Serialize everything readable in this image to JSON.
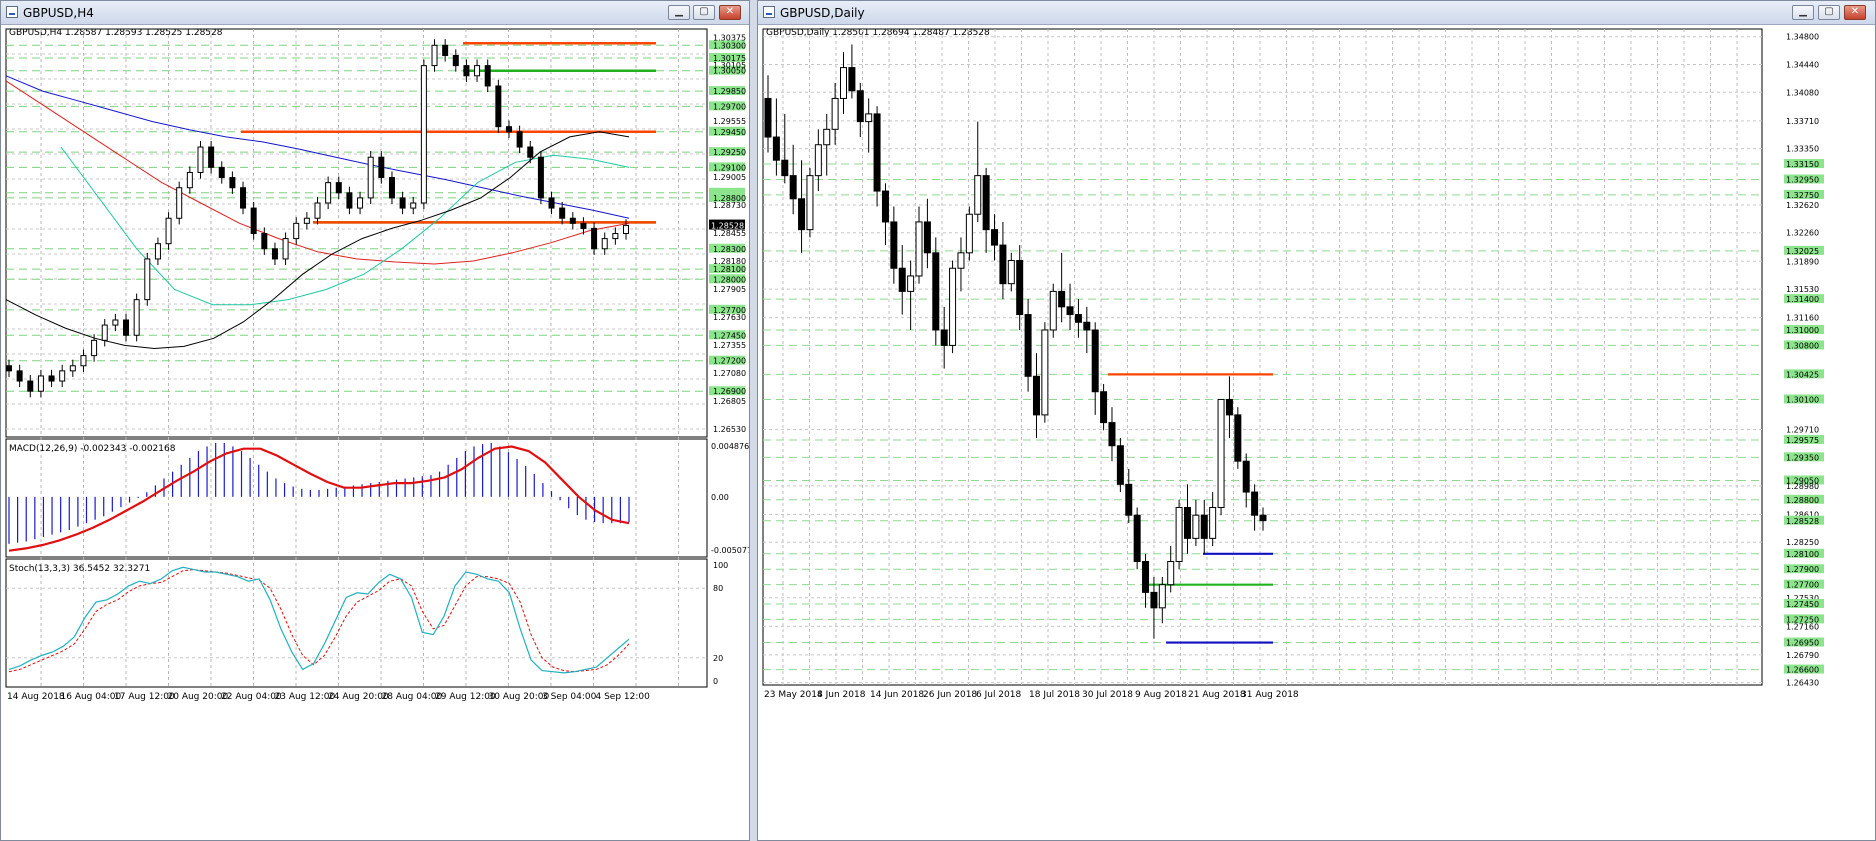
{
  "left_window": {
    "title": "GBPUSD,H4",
    "header": "GBPUSD,H4  1.28587 1.28593 1.28525 1.28528",
    "price_scale": [
      "1.30375",
      "1.30300",
      "1.30175",
      "1.30105",
      "1.30050",
      "1.29850",
      "1.29700",
      "1.29555",
      "1.29450",
      "1.29250",
      "1.29100",
      "1.29005",
      "1.28800",
      "1.28730",
      "1.28528",
      "1.28455",
      "1.28300",
      "1.28180",
      "1.28100",
      "1.28000",
      "1.27905",
      "1.27700",
      "1.27630",
      "1.27450",
      "1.27355",
      "1.27200",
      "1.27080",
      "1.26900",
      "1.26805",
      "1.26530"
    ],
    "price_levels_green": [
      1.303,
      1.30175,
      1.3005,
      1.2985,
      1.297,
      1.2945,
      1.2925,
      1.291,
      1.2885,
      1.288,
      1.283,
      1.281,
      1.28,
      1.277,
      1.2745,
      1.272,
      1.269
    ],
    "current_price": "1.28528",
    "dates": [
      "14 Aug 2018",
      "16 Aug 04:00",
      "17 Aug 12:00",
      "20 Aug 20:00",
      "22 Aug 04:00",
      "23 Aug 12:00",
      "24 Aug 20:00",
      "28 Aug 04:00",
      "29 Aug 12:00",
      "30 Aug 20:00",
      "3 Sep 04:00",
      "4 Sep 12:00"
    ],
    "macd_label": "MACD(12,26,9) -0.002343 -0.002168",
    "macd_scale": [
      "0.004876",
      "0.00",
      "-0.005077"
    ],
    "stoch_label": "Stoch(13,3,3) 36.5452 32.3271",
    "stoch_scale": [
      "100",
      "80",
      "20",
      "0"
    ],
    "horizontal_lines": [
      {
        "price": 1.3032,
        "color": "#ff4500"
      },
      {
        "price": 1.3005,
        "color": "#22b022"
      },
      {
        "price": 1.2945,
        "color": "#22b022"
      },
      {
        "price": 1.2945,
        "color": "#ff4500",
        "partial": true
      },
      {
        "price": 1.2856,
        "color": "#22b022"
      },
      {
        "price": 1.2856,
        "color": "#ff4500",
        "partial": true
      }
    ]
  },
  "right_window": {
    "title": "GBPUSD,Daily",
    "header": "GBPUSD,Daily  1.28501 1.28694 1.28487 1.28528",
    "price_scale": [
      "1.34800",
      "1.34440",
      "1.34080",
      "1.33710",
      "1.33350",
      "1.33150",
      "1.32950",
      "1.32750",
      "1.32620",
      "1.32260",
      "1.32025",
      "1.31890",
      "1.31530",
      "1.31400",
      "1.31160",
      "1.31000",
      "1.30800",
      "1.30425",
      "1.30100",
      "1.29710",
      "1.29575",
      "1.29350",
      "1.29050",
      "1.28980",
      "1.28800",
      "1.28610",
      "1.28528",
      "1.28250",
      "1.28100",
      "1.27900",
      "1.27700",
      "1.27530",
      "1.27450",
      "1.27250",
      "1.27160",
      "1.26950",
      "1.26790",
      "1.26600",
      "1.26430"
    ],
    "dates": [
      "23 May 2018",
      "4 Jun 2018",
      "14 Jun 2018",
      "26 Jun 2018",
      "6 Jul 2018",
      "18 Jul 2018",
      "30 Jul 2018",
      "9 Aug 2018",
      "21 Aug 2018",
      "31 Aug 2018"
    ],
    "horizontal_lines": [
      {
        "price": 1.30425,
        "color": "#ff4500"
      },
      {
        "price": 1.281,
        "color": "#1010c0"
      },
      {
        "price": 1.277,
        "color": "#22b022"
      },
      {
        "price": 1.2695,
        "color": "#1010c0"
      }
    ]
  },
  "chart_data": [
    {
      "type": "candlestick",
      "title": "GBPUSD,H4",
      "ylim": [
        1.2645,
        1.3046
      ],
      "x_ticks": [
        "14 Aug 2018",
        "16 Aug 04:00",
        "17 Aug 12:00",
        "20 Aug 20:00",
        "22 Aug 04:00",
        "23 Aug 12:00",
        "24 Aug 20:00",
        "28 Aug 04:00",
        "29 Aug 12:00",
        "30 Aug 20:00",
        "3 Sep 04:00",
        "4 Sep 12:00"
      ],
      "close_path": [
        1.271,
        1.27,
        1.269,
        1.2705,
        1.27,
        1.271,
        1.2715,
        1.2725,
        1.274,
        1.2755,
        1.276,
        1.2745,
        1.278,
        1.282,
        1.2835,
        1.286,
        1.289,
        1.2905,
        1.293,
        1.291,
        1.29,
        1.289,
        1.287,
        1.2845,
        1.283,
        1.282,
        1.284,
        1.2855,
        1.286,
        1.2875,
        1.2895,
        1.2885,
        1.287,
        1.288,
        1.292,
        1.29,
        1.288,
        1.287,
        1.2875,
        1.301,
        1.303,
        1.302,
        1.301,
        1.3,
        1.301,
        1.299,
        1.295,
        1.2945,
        1.293,
        1.292,
        1.288,
        1.287,
        1.286,
        1.2855,
        1.285,
        1.283,
        1.284,
        1.2845,
        1.2853
      ],
      "ma_black": [
        1.278,
        1.2765,
        1.2752,
        1.2742,
        1.2735,
        1.2732,
        1.2734,
        1.2742,
        1.2758,
        1.278,
        1.2805,
        1.2825,
        1.284,
        1.285,
        1.2858,
        1.2868,
        1.288,
        1.29,
        1.2925,
        1.294,
        1.2945,
        1.294
      ],
      "ma_blue": [
        1.3,
        1.2985,
        1.2975,
        1.2965,
        1.2955,
        1.2947,
        1.294,
        1.2935,
        1.2928,
        1.292,
        1.2912,
        1.2905,
        1.2898,
        1.289,
        1.2882,
        1.2875,
        1.2868,
        1.286
      ],
      "ma_red": [
        1.2995,
        1.297,
        1.2945,
        1.292,
        1.2895,
        1.2875,
        1.2855,
        1.284,
        1.2827,
        1.282,
        1.2817,
        1.2815,
        1.2818,
        1.2826,
        1.2836,
        1.2848,
        1.2855
      ],
      "ma_cyan": [
        1.293,
        1.288,
        1.283,
        1.279,
        1.2775,
        1.2775,
        1.278,
        1.279,
        1.2805,
        1.283,
        1.286,
        1.2895,
        1.2915,
        1.2922,
        1.2918,
        1.291
      ]
    },
    {
      "type": "bar",
      "title": "MACD(12,26,9)",
      "ylim": [
        -0.005077,
        0.004876
      ],
      "histogram": [
        -0.0041,
        -0.004,
        -0.0039,
        -0.0037,
        -0.0035,
        -0.0033,
        -0.0031,
        -0.0029,
        -0.0026,
        -0.0023,
        -0.002,
        -0.0017,
        -0.0013,
        -0.0009,
        -0.0005,
        -0.0001,
        0.0004,
        0.001,
        0.0016,
        0.0022,
        0.0028,
        0.0034,
        0.004,
        0.0044,
        0.0047,
        0.0047,
        0.0044,
        0.004,
        0.0034,
        0.0028,
        0.0022,
        0.0016,
        0.0012,
        0.0009,
        0.0007,
        0.0006,
        0.0006,
        0.0007,
        0.0008,
        0.0009,
        0.001,
        0.0011,
        0.0012,
        0.0013,
        0.0014,
        0.0015,
        0.0016,
        0.0017,
        0.0018,
        0.0019,
        0.0022,
        0.0028,
        0.0034,
        0.004,
        0.0044,
        0.0046,
        0.0047,
        0.0044,
        0.0039,
        0.0033,
        0.0027,
        0.002,
        0.0012,
        0.0005,
        -0.0003,
        -0.001,
        -0.0016,
        -0.002,
        -0.0022,
        -0.0023,
        -0.0023,
        -0.0023,
        -0.0022
      ],
      "signal": [
        -0.0047,
        -0.0045,
        -0.0042,
        -0.0038,
        -0.0033,
        -0.0027,
        -0.002,
        -0.0012,
        -0.0004,
        0.0005,
        0.0014,
        0.0022,
        0.0031,
        0.0038,
        0.0042,
        0.0042,
        0.0036,
        0.0028,
        0.002,
        0.0013,
        0.0008,
        0.0008,
        0.001,
        0.0012,
        0.0012,
        0.0014,
        0.0017,
        0.0024,
        0.0034,
        0.0042,
        0.0044,
        0.004,
        0.003,
        0.0015,
        0.0,
        -0.0012,
        -0.002,
        -0.0023
      ]
    },
    {
      "type": "line",
      "title": "Stoch(13,3,3)",
      "ylim": [
        0,
        100
      ],
      "main": [
        10,
        13,
        18,
        22,
        25,
        30,
        38,
        55,
        68,
        70,
        75,
        82,
        86,
        84,
        88,
        95,
        98,
        96,
        94,
        94,
        92,
        90,
        86,
        88,
        70,
        45,
        25,
        10,
        15,
        32,
        52,
        72,
        76,
        75,
        85,
        92,
        88,
        72,
        42,
        40,
        56,
        82,
        94,
        92,
        88,
        86,
        76,
        45,
        18,
        9,
        8,
        7,
        8,
        10,
        12,
        20,
        28,
        36
      ],
      "signal": [
        8,
        10,
        14,
        18,
        22,
        26,
        32,
        45,
        60,
        66,
        70,
        77,
        82,
        84,
        85,
        90,
        95,
        96,
        95,
        94,
        93,
        91,
        89,
        87,
        80,
        62,
        40,
        22,
        14,
        22,
        38,
        56,
        68,
        73,
        78,
        86,
        88,
        82,
        60,
        45,
        48,
        65,
        82,
        90,
        90,
        88,
        84,
        68,
        40,
        20,
        12,
        9,
        8,
        9,
        10,
        14,
        22,
        32
      ]
    },
    {
      "type": "candlestick",
      "title": "GBPUSD,Daily",
      "ylim": [
        1.264,
        1.349
      ],
      "x_ticks": [
        "23 May 2018",
        "4 Jun 2018",
        "14 Jun 2018",
        "26 Jun 2018",
        "6 Jul 2018",
        "18 Jul 2018",
        "30 Jul 2018",
        "9 Aug 2018",
        "21 Aug 2018",
        "31 Aug 2018"
      ],
      "candles": [
        [
          1.34,
          1.343,
          1.333,
          1.335
        ],
        [
          1.335,
          1.34,
          1.33,
          1.332
        ],
        [
          1.332,
          1.338,
          1.329,
          1.33
        ],
        [
          1.33,
          1.334,
          1.325,
          1.327
        ],
        [
          1.327,
          1.332,
          1.32,
          1.323
        ],
        [
          1.323,
          1.331,
          1.322,
          1.33
        ],
        [
          1.33,
          1.336,
          1.328,
          1.334
        ],
        [
          1.334,
          1.338,
          1.33,
          1.336
        ],
        [
          1.336,
          1.342,
          1.334,
          1.34
        ],
        [
          1.34,
          1.346,
          1.338,
          1.344
        ],
        [
          1.344,
          1.347,
          1.34,
          1.341
        ],
        [
          1.341,
          1.342,
          1.335,
          1.337
        ],
        [
          1.337,
          1.34,
          1.333,
          1.338
        ],
        [
          1.338,
          1.339,
          1.326,
          1.328
        ],
        [
          1.328,
          1.329,
          1.321,
          1.324
        ],
        [
          1.324,
          1.326,
          1.316,
          1.318
        ],
        [
          1.318,
          1.321,
          1.312,
          1.315
        ],
        [
          1.315,
          1.319,
          1.31,
          1.317
        ],
        [
          1.317,
          1.326,
          1.316,
          1.324
        ],
        [
          1.324,
          1.327,
          1.318,
          1.32
        ],
        [
          1.32,
          1.322,
          1.308,
          1.31
        ],
        [
          1.31,
          1.313,
          1.305,
          1.308
        ],
        [
          1.308,
          1.319,
          1.307,
          1.318
        ],
        [
          1.318,
          1.322,
          1.315,
          1.32
        ],
        [
          1.32,
          1.326,
          1.319,
          1.325
        ],
        [
          1.325,
          1.337,
          1.324,
          1.33
        ],
        [
          1.33,
          1.331,
          1.32,
          1.323
        ],
        [
          1.323,
          1.325,
          1.319,
          1.321
        ],
        [
          1.321,
          1.324,
          1.314,
          1.316
        ],
        [
          1.316,
          1.32,
          1.315,
          1.319
        ],
        [
          1.319,
          1.321,
          1.31,
          1.312
        ],
        [
          1.312,
          1.314,
          1.302,
          1.304
        ],
        [
          1.304,
          1.307,
          1.296,
          1.299
        ],
        [
          1.299,
          1.311,
          1.298,
          1.31
        ],
        [
          1.31,
          1.316,
          1.309,
          1.315
        ],
        [
          1.315,
          1.32,
          1.311,
          1.313
        ],
        [
          1.313,
          1.316,
          1.31,
          1.312
        ],
        [
          1.312,
          1.314,
          1.309,
          1.311
        ],
        [
          1.311,
          1.313,
          1.307,
          1.31
        ],
        [
          1.31,
          1.311,
          1.299,
          1.302
        ],
        [
          1.302,
          1.303,
          1.297,
          1.298
        ],
        [
          1.298,
          1.3,
          1.293,
          1.295
        ],
        [
          1.295,
          1.296,
          1.289,
          1.29
        ],
        [
          1.29,
          1.292,
          1.285,
          1.286
        ],
        [
          1.286,
          1.287,
          1.279,
          1.28
        ],
        [
          1.28,
          1.281,
          1.274,
          1.276
        ],
        [
          1.276,
          1.278,
          1.27,
          1.274
        ],
        [
          1.274,
          1.278,
          1.272,
          1.277
        ],
        [
          1.277,
          1.282,
          1.276,
          1.28
        ],
        [
          1.28,
          1.288,
          1.279,
          1.287
        ],
        [
          1.287,
          1.29,
          1.281,
          1.283
        ],
        [
          1.283,
          1.288,
          1.282,
          1.286
        ],
        [
          1.286,
          1.288,
          1.281,
          1.283
        ],
        [
          1.283,
          1.289,
          1.282,
          1.287
        ],
        [
          1.287,
          1.297,
          1.286,
          1.301
        ],
        [
          1.301,
          1.304,
          1.296,
          1.299
        ],
        [
          1.299,
          1.3,
          1.292,
          1.293
        ],
        [
          1.293,
          1.294,
          1.287,
          1.289
        ],
        [
          1.289,
          1.29,
          1.284,
          1.286
        ],
        [
          1.286,
          1.287,
          1.284,
          1.2853
        ]
      ]
    }
  ]
}
